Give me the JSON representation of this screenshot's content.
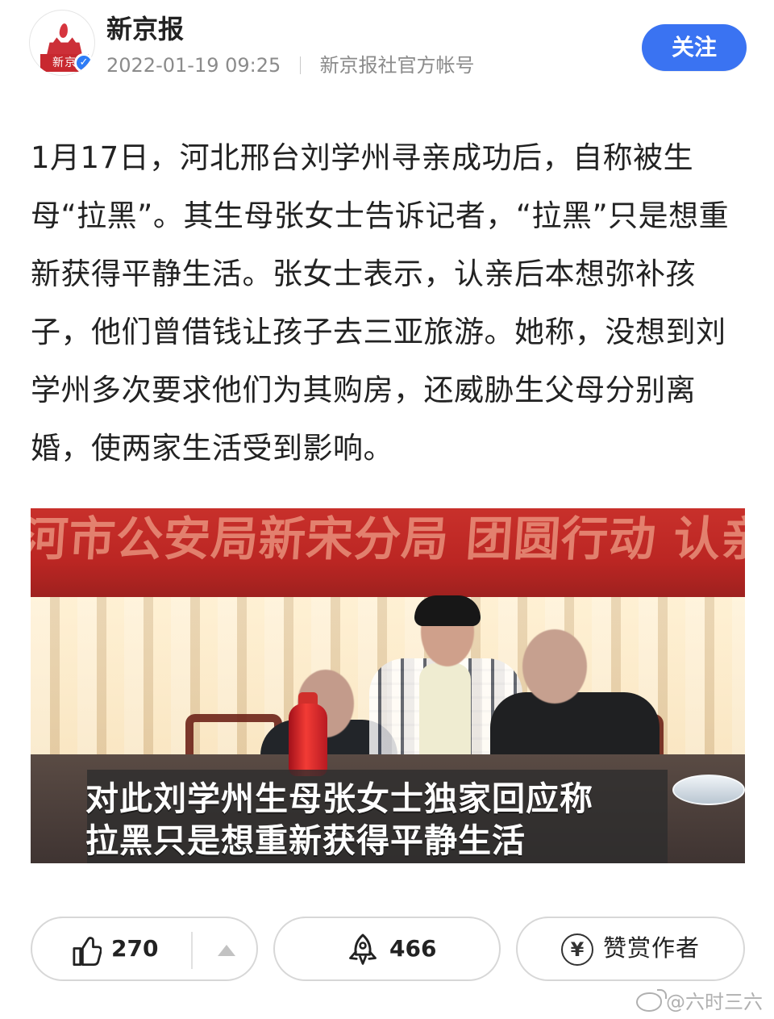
{
  "post": {
    "source_name": "新京报",
    "avatar_text": "新京",
    "verified_icon": "check-icon",
    "timestamp": "2022-01-19 09:25",
    "account_type": "新京报社官方帐号",
    "follow_label": "关注",
    "body": "1月17日，河北邢台刘学州寻亲成功后，自称被生母“拉黑”。其生母张女士告诉记者，“拉黑”只是想重新获得平静生活。张女士表示，认亲后本想弥补孩子，他们曾借钱让孩子去三亚旅游。她称，没想到刘学州多次要求他们为其购房，还威胁生父母分别离婚，使两家生活受到影响。"
  },
  "image": {
    "banner_text": "河市公安局新宋分局   团圆行动   认亲",
    "caption_line_1": "对此刘学州生母张女士独家回应称",
    "caption_line_2": "拉黑只是想重新获得平静生活"
  },
  "actions": {
    "like_icon": "thumbs-up-icon",
    "like_count": "270",
    "dislike_icon": "triangle-up-icon",
    "repost_icon": "rocket-icon",
    "repost_count": "466",
    "tip_icon": "yen-icon",
    "tip_label": "赞赏作者"
  },
  "watermark": {
    "icon": "weibo-icon",
    "text": "@六时三六"
  },
  "colors": {
    "accent": "#3A73F2",
    "text": "#222222",
    "muted": "#8B8B8B",
    "border": "#D7D7D7"
  }
}
